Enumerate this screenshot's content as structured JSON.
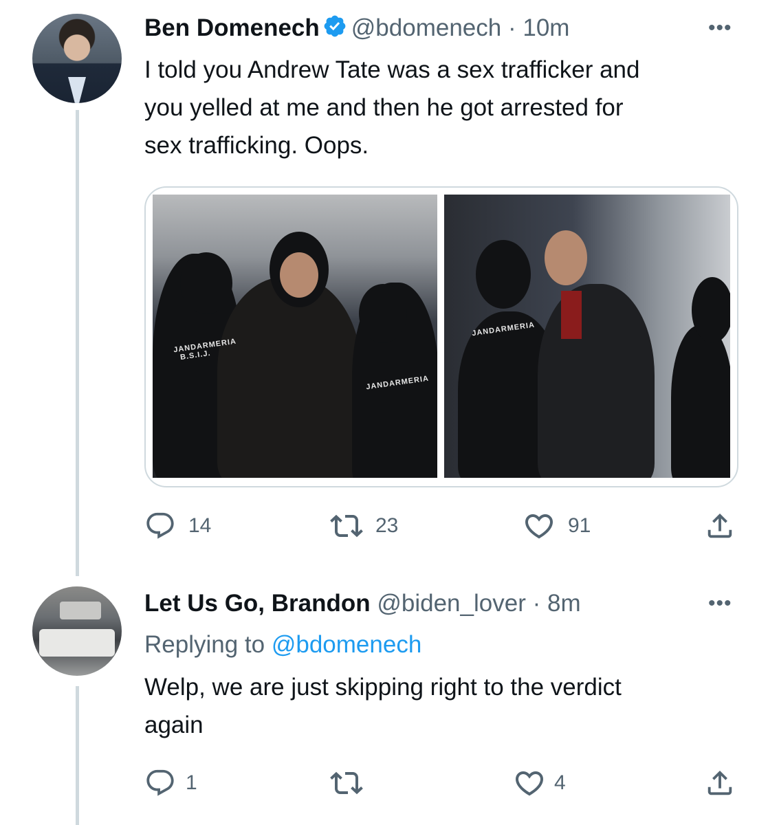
{
  "tweets": [
    {
      "name": "Ben Domenech",
      "verified": true,
      "handle": "@bdomenech",
      "separator": "·",
      "time": "10m",
      "text_lines": [
        "I told you Andrew Tate was a sex trafficker and",
        "you yelled at me and then he got arrested for",
        "sex trafficking. Oops."
      ],
      "media": {
        "photo_count": 2,
        "vest_labels": [
          "JANDARMERIA",
          "B.S.I.J.",
          "JANDARMERIA",
          "JANDARMERIA"
        ]
      },
      "actions": {
        "reply_icon": "reply-icon",
        "reply_count": "14",
        "retweet_icon": "retweet-icon",
        "retweet_count": "23",
        "like_icon": "heart-icon",
        "like_count": "91",
        "share_icon": "share-icon"
      }
    },
    {
      "name": "Let Us Go, Brandon",
      "verified": false,
      "handle": "@biden_lover",
      "separator": "·",
      "time": "8m",
      "replying_prefix": "Replying to",
      "replying_to": "@bdomenech",
      "text_lines": [
        "Welp, we are just skipping right to the verdict",
        "again"
      ],
      "actions": {
        "reply_icon": "reply-icon",
        "reply_count": "1",
        "retweet_icon": "retweet-icon",
        "retweet_count": "",
        "like_icon": "heart-icon",
        "like_count": "4",
        "share_icon": "share-icon"
      }
    }
  ],
  "more_menu": "•••",
  "colors": {
    "verified": "#1d9bf0",
    "mention": "#1d9bf0",
    "secondary_text": "#536471",
    "thread_line": "#cfd9de"
  }
}
